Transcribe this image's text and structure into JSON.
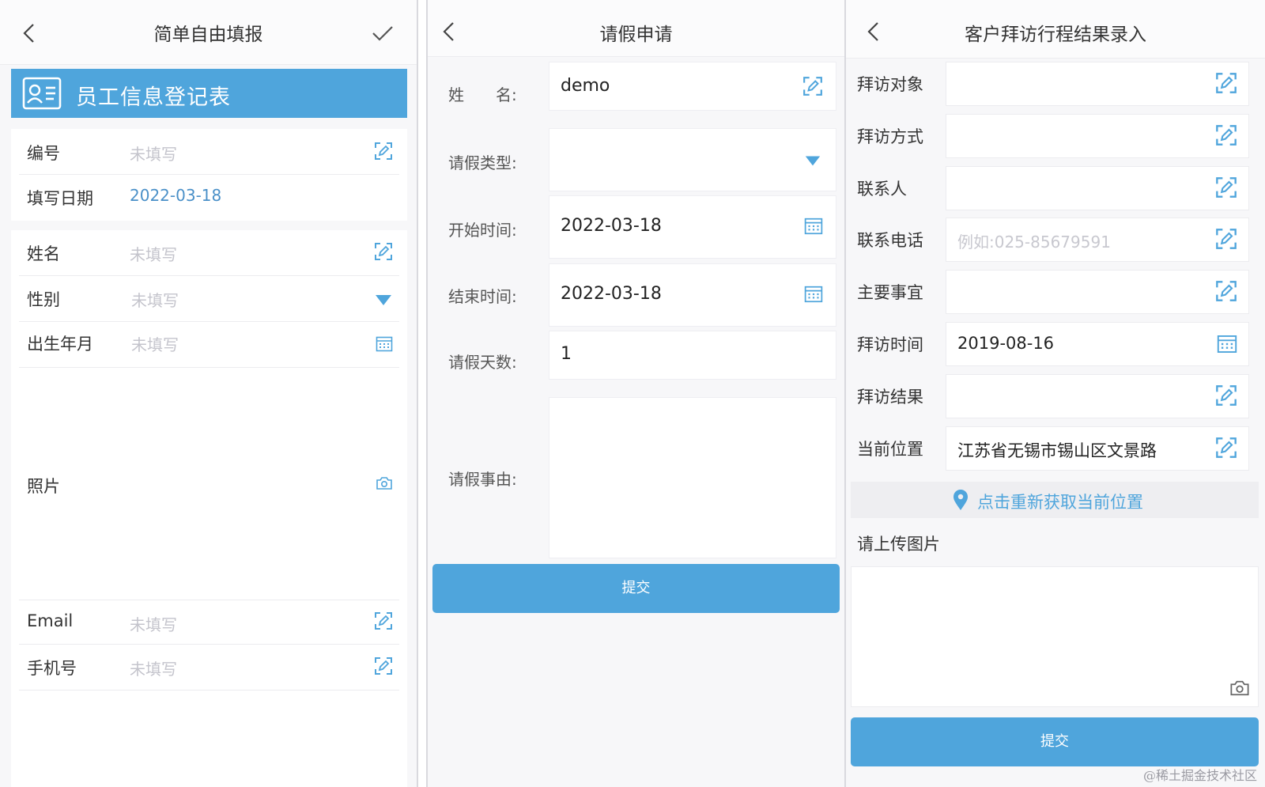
{
  "colors": {
    "accent": "#4fa5dc",
    "placeholder": "#c4c4cc",
    "date": "#4a90c8"
  },
  "panel1": {
    "title": "简单自由填报",
    "banner": "员工信息登记表",
    "rows": [
      {
        "label": "编号",
        "value": "未填写",
        "icon": "edit-icon"
      },
      {
        "label": "填写日期",
        "value": "2022-03-18"
      },
      {
        "label": "姓名",
        "value": "未填写",
        "icon": "edit-icon"
      },
      {
        "label": "性别",
        "value": "未填写",
        "icon": "dropdown-triangle-icon"
      },
      {
        "label": "出生年月",
        "value": "未填写",
        "icon": "calendar-icon"
      },
      {
        "label": "照片",
        "icon": "camera-icon"
      },
      {
        "label": "Email",
        "value": "未填写",
        "icon": "edit-icon"
      },
      {
        "label": "手机号",
        "value": "未填写",
        "icon": "edit-icon"
      }
    ]
  },
  "panel2": {
    "title": "请假申请",
    "fields": [
      {
        "label": "姓　　名:",
        "value": "demo",
        "icon": "edit-icon"
      },
      {
        "label": "请假类型:",
        "value": "",
        "icon": "dropdown-triangle-icon"
      },
      {
        "label": "开始时间:",
        "value": "2022-03-18",
        "icon": "calendar-icon"
      },
      {
        "label": "结束时间:",
        "value": "2022-03-18",
        "icon": "calendar-icon"
      },
      {
        "label": "请假天数:",
        "value": "1"
      },
      {
        "label": "请假事由:",
        "value": ""
      }
    ],
    "submit": "提交"
  },
  "panel3": {
    "title": "客户拜访行程结果录入",
    "fields": [
      {
        "label": "拜访对象",
        "value": "",
        "icon": "edit-icon"
      },
      {
        "label": "拜访方式",
        "value": "",
        "icon": "edit-icon"
      },
      {
        "label": "联系人",
        "value": "",
        "icon": "edit-icon"
      },
      {
        "label": "联系电话",
        "value": "",
        "placeholder": "例如:025-85679591",
        "icon": "edit-icon"
      },
      {
        "label": "主要事宜",
        "value": "",
        "icon": "edit-icon"
      },
      {
        "label": "拜访时间",
        "value": "2019-08-16",
        "icon": "calendar-icon"
      },
      {
        "label": "拜访结果",
        "value": "",
        "icon": "edit-icon"
      },
      {
        "label": "当前位置",
        "value": "江苏省无锡市锡山区文景路",
        "icon": "edit-icon"
      }
    ],
    "relocate": "点击重新获取当前位置",
    "upload_label": "请上传图片",
    "submit": "提交"
  },
  "watermark": "@稀土掘金技术社区"
}
